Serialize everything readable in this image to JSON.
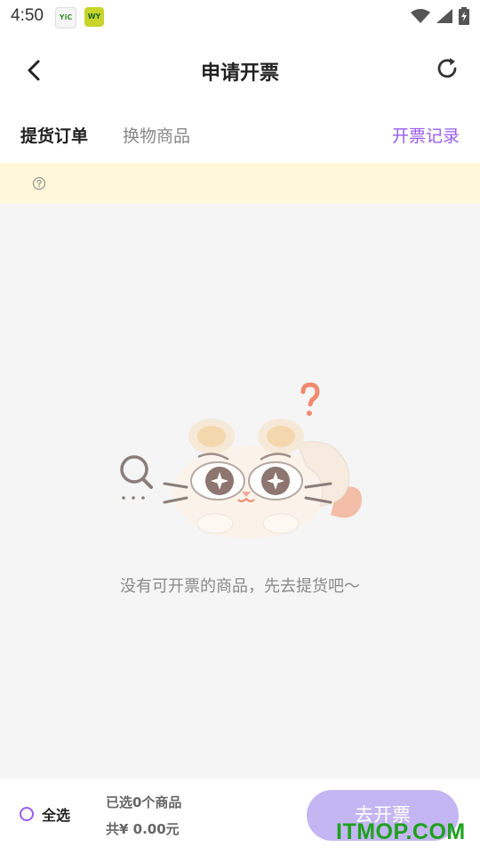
{
  "status_bar": {
    "time": "4:50",
    "app_icon_1": "YiC",
    "app_icon_2": "WY"
  },
  "header": {
    "title": "申请开票"
  },
  "tabs": {
    "items": [
      {
        "label": "提货订单",
        "active": true
      },
      {
        "label": "换物商品",
        "active": false
      }
    ],
    "record_link": "开票记录"
  },
  "notice": {
    "icon": "question-circle-icon"
  },
  "empty_state": {
    "message": "没有可开票的商品，先去提货吧～",
    "illustration": "cat-with-magnifier"
  },
  "bottom_bar": {
    "select_all_label": "全选",
    "selected_count_text": "已选0个商品",
    "total_text": "共¥ 0.00元",
    "invoice_button": "去开票"
  },
  "watermark": "ITMOP.COM",
  "colors": {
    "accent": "#9a5cf0",
    "button_disabled": "#c3b6f2",
    "notice_bg": "#fff7d8",
    "content_bg": "#f5f5f5"
  }
}
